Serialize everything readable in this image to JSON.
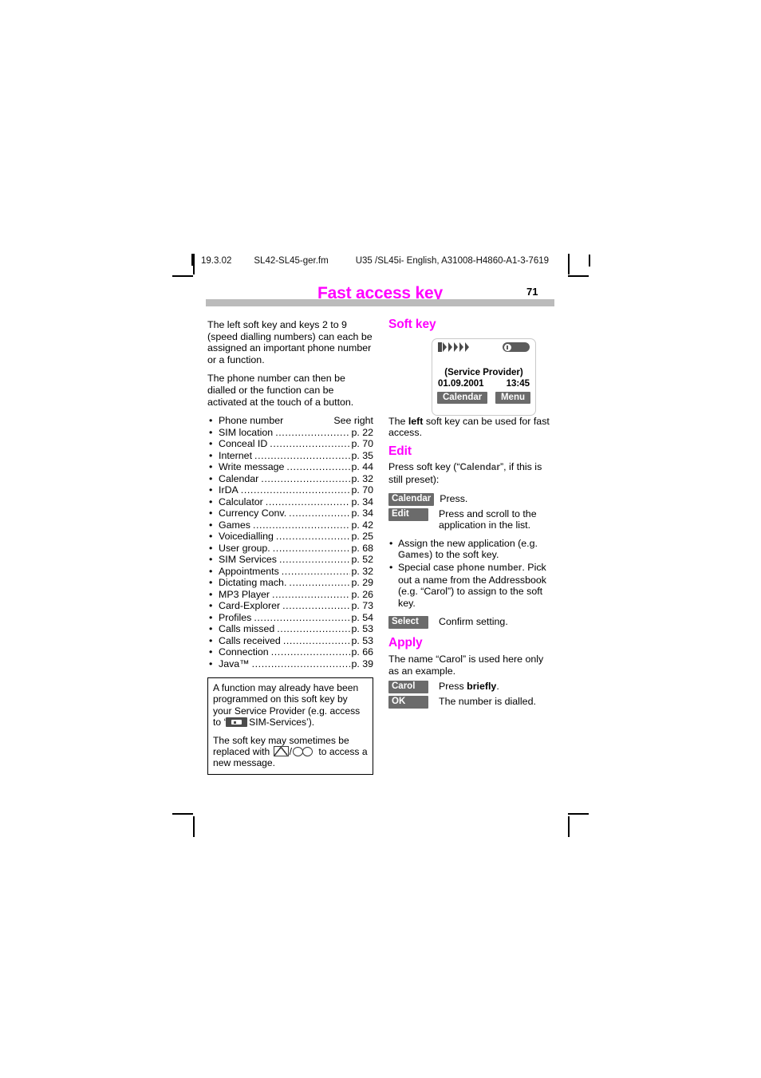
{
  "print_header": {
    "date": "19.3.02",
    "filename": "SL42-SL45-ger.fm",
    "doc_ref": "U35 /SL45i- English, A31008-H4860-A1-3-7619"
  },
  "page": {
    "title": "Fast access key",
    "number": "71",
    "title_color": "#ff00ff",
    "rule_color": "#bbbbbb"
  },
  "left_column": {
    "intro1": "The left soft key and keys 2 to 9 (speed dialling numbers) can each be assigned an important phone number or a function.",
    "intro2": "The phone number can then be dialled or the function can be activated at the touch of a button.",
    "list": [
      {
        "label": "Phone number",
        "page": "See right",
        "dots": false
      },
      {
        "label": "SIM location",
        "page": "p. 22",
        "dots": true
      },
      {
        "label": "Conceal ID",
        "page": "p. 70",
        "dots": true
      },
      {
        "label": "Internet",
        "page": "p. 35",
        "dots": true
      },
      {
        "label": "Write message",
        "page": "p. 44",
        "dots": true
      },
      {
        "label": "Calendar",
        "page": "p. 32",
        "dots": true
      },
      {
        "label": "IrDA",
        "page": "p. 70",
        "dots": true
      },
      {
        "label": "Calculator",
        "page": "p. 34",
        "dots": true
      },
      {
        "label": "Currency Conv.",
        "page": "p. 34",
        "dots": true
      },
      {
        "label": "Games",
        "page": "p. 42",
        "dots": true
      },
      {
        "label": "Voicedialling",
        "page": "p. 25",
        "dots": true
      },
      {
        "label": "User group.",
        "page": "p. 68",
        "dots": true
      },
      {
        "label": "SIM Services",
        "page": "p. 52",
        "dots": true
      },
      {
        "label": "Appointments",
        "page": "p. 32",
        "dots": true
      },
      {
        "label": "Dictating mach.",
        "page": "p. 29",
        "dots": true
      },
      {
        "label": "MP3 Player",
        "page": "p. 26",
        "dots": true
      },
      {
        "label": "Card-Explorer",
        "page": "p. 73",
        "dots": true
      },
      {
        "label": "Profiles",
        "page": "p. 54",
        "dots": true
      },
      {
        "label": "Calls missed",
        "page": "p. 53",
        "dots": true
      },
      {
        "label": "Calls received",
        "page": "p. 53",
        "dots": true
      },
      {
        "label": "Connection",
        "page": "p. 66",
        "dots": true
      },
      {
        "label": "Java™",
        "page": "p. 39",
        "dots": true
      }
    ],
    "bullet_char": "•"
  },
  "note_box": {
    "p1_a": "A function may already have been programmed on this soft key by your Service Provider (e.g. access to ‘",
    "p1_b": "SIM-Services’).",
    "p2_a": "The soft key may sometimes be replaced with",
    "p2_sep": "/",
    "p2_b": "to access a new message.",
    "icons": [
      "sim-services-icon",
      "envelope-icon",
      "voicemail-icon"
    ]
  },
  "right_column": {
    "soft_key_heading": "Soft key",
    "phone_display": {
      "signal_icon": "signal-strength-icon",
      "battery_icon": "battery-icon",
      "provider": "(Service Provider)",
      "date": "01.09.2001",
      "time": "13:45",
      "left_softkey": "Calendar",
      "right_softkey": "Menu"
    },
    "intro_a": "The",
    "intro_bold": "left",
    "intro_b": "soft key can be used for fast access.",
    "edit": {
      "heading": "Edit",
      "intro_a": "Press soft key (“",
      "intro_ui": "Calendar",
      "intro_b": "”, if this is still preset):",
      "rows": [
        {
          "key": "Calendar",
          "text": "Press."
        },
        {
          "key": "Edit",
          "text": "Press and scroll to the application in the list."
        }
      ],
      "bullets": [
        {
          "a": "Assign the new application (e.g. ",
          "ui": "Games",
          "b": ") to the soft key."
        },
        {
          "a": "Special case ",
          "ui": "phone number",
          "b": ". Pick out a name from the Addressbook (e.g. “Carol”) to assign to the soft key."
        }
      ],
      "confirm_row": {
        "key": "Select",
        "text": "Confirm setting."
      }
    },
    "apply": {
      "heading": "Apply",
      "intro": "The name “Carol” is used here only as an example.",
      "rows": [
        {
          "key": "Carol",
          "text_a": "Press ",
          "text_bold": "briefly",
          "text_b": "."
        },
        {
          "key": "OK",
          "text_a": "The number is dialled.",
          "text_bold": "",
          "text_b": ""
        }
      ]
    }
  }
}
